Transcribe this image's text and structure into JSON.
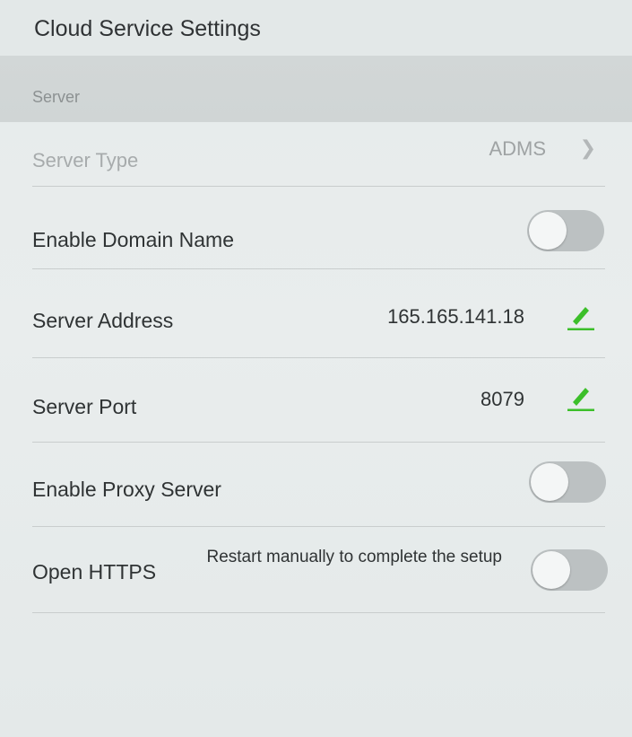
{
  "header": {
    "title": "Cloud Service Settings"
  },
  "section": {
    "label": "Server"
  },
  "rows": {
    "server_type": {
      "label": "Server Type",
      "value": "ADMS"
    },
    "enable_domain_name": {
      "label": "Enable Domain Name",
      "enabled": false
    },
    "server_address": {
      "label": "Server Address",
      "value": "165.165.141.18"
    },
    "server_port": {
      "label": "Server Port",
      "value": "8079"
    },
    "enable_proxy_server": {
      "label": "Enable Proxy Server",
      "enabled": false
    },
    "open_https": {
      "label": "Open HTTPS",
      "note": "Restart manually to complete the setup",
      "enabled": false
    }
  },
  "icons": {
    "edit": "pencil-icon",
    "chevron": "chevron-right-icon"
  },
  "colors": {
    "accent_green": "#3cbf2a",
    "toggle_off": "#bcc1c2",
    "section_bg": "#d2d7d7"
  }
}
